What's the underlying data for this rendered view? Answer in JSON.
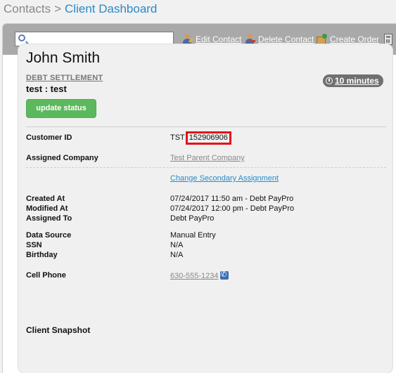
{
  "breadcrumb": {
    "parent": "Contacts",
    "separator": ">",
    "current": "Client Dashboard"
  },
  "toolbar": {
    "search_placeholder": "",
    "edit_contact": "Edit Contact",
    "delete_contact": "Delete Contact",
    "create_order": "Create Order"
  },
  "client": {
    "name": "John Smith",
    "case_type": "DEBT SETTLEMENT",
    "case_sub": "test : test",
    "timer": "10 minutes",
    "update_status": "update status"
  },
  "details": {
    "customer_id_label": "Customer ID",
    "customer_id_prefix": "TST",
    "customer_id_number": "152906906",
    "assigned_company_label": "Assigned Company",
    "assigned_company": "Test Parent Company",
    "change_secondary": "Change Secondary Assignment",
    "created_at_label": "Created At",
    "created_at": "07/24/2017 11:50 am - Debt PayPro",
    "modified_at_label": "Modified At",
    "modified_at": "07/24/2017 12:00 pm - Debt PayPro",
    "assigned_to_label": "Assigned To",
    "assigned_to": "Debt PayPro",
    "data_source_label": "Data Source",
    "data_source": "Manual Entry",
    "ssn_label": "SSN",
    "ssn": "N/A",
    "birthday_label": "Birthday",
    "birthday": "N/A",
    "cell_phone_label": "Cell Phone",
    "cell_phone": "630-555-1234"
  },
  "snapshot_title": "Client Snapshot",
  "colors": {
    "accent_blue": "#2a8ac7",
    "button_green": "#5cb85c",
    "highlight_red": "#e3121b",
    "toolbar_gray": "#a9a9a9"
  },
  "icons": [
    "search-icon",
    "edit-contact-icon",
    "delete-contact-icon",
    "create-order-icon",
    "calculator-icon",
    "clock-icon",
    "phone-icon"
  ]
}
